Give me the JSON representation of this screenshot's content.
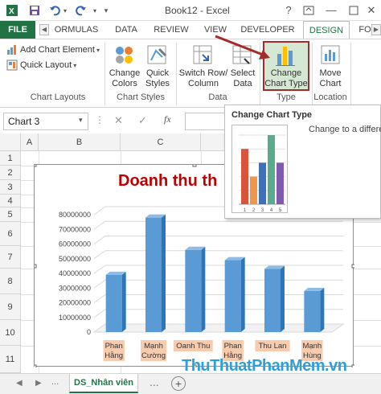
{
  "title_bar": {
    "file_label": "X",
    "doc_title": "Book12 - Excel",
    "help": "?",
    "minimize": "—",
    "close": "✕"
  },
  "tabs": {
    "file": "FILE",
    "items": [
      "ORMULAS",
      "DATA",
      "REVIEW",
      "VIEW",
      "DEVELOPER",
      "DESIGN",
      "FO"
    ]
  },
  "ribbon": {
    "add_chart_element": "Add Chart Element",
    "quick_layout": "Quick Layout",
    "chart_layouts_label": "Chart Layouts",
    "change_colors_l1": "Change",
    "change_colors_l2": "Colors",
    "quick_styles_l1": "Quick",
    "quick_styles_l2": "Styles",
    "chart_styles_label": "Chart Styles",
    "switch_rc_l1": "Switch Row/",
    "switch_rc_l2": "Column",
    "select_data_l1": "Select",
    "select_data_l2": "Data",
    "data_label": "Data",
    "change_type_l1": "Change",
    "change_type_l2": "Chart Type",
    "type_label": "Type",
    "move_chart_l1": "Move",
    "move_chart_l2": "Chart",
    "location_label": "Location"
  },
  "formula_bar": {
    "name_box": "Chart 3",
    "cancel": "✕",
    "enter": "✓",
    "fx": "fx"
  },
  "grid": {
    "columns": [
      "A",
      "B",
      "C"
    ],
    "rows": [
      "1",
      "2",
      "3",
      "4",
      "5",
      "6",
      "7",
      "8",
      "9",
      "10",
      "11"
    ]
  },
  "tooltip": {
    "title": "Change Chart Type",
    "description": "Change to a differe",
    "preview_values": [
      4,
      2,
      3,
      5,
      3
    ],
    "preview_labels": [
      "1",
      "2",
      "3",
      "4",
      "5"
    ],
    "preview_colors": [
      "#d9543a",
      "#f0964a",
      "#3f6fb6",
      "#5aab8b",
      "#7f5ab0"
    ]
  },
  "chart_data": {
    "type": "bar",
    "title": "Doanh thu th",
    "categories": [
      "Phan\nHằng",
      "Mạnh\nCường",
      "Oanh Thu",
      "Phan\nHằng",
      "Thu Lan",
      "Mạnh\nHùng"
    ],
    "values": [
      39000000,
      78000000,
      56000000,
      49000000,
      43000000,
      28000000
    ],
    "ylim": [
      0,
      80000000
    ],
    "yticks": [
      "80000000",
      "70000000",
      "60000000",
      "50000000",
      "40000000",
      "30000000",
      "20000000",
      "10000000",
      "0"
    ],
    "bar_color": "#5b9bd5",
    "label_bg": "#f8cbad"
  },
  "sheets": {
    "active": "DS_Nhân viên",
    "add": "+",
    "nav_prev": "◀",
    "nav_next": "▶",
    "ellipsis": "..."
  },
  "watermark": "ThuThuatPhanMem.vn"
}
